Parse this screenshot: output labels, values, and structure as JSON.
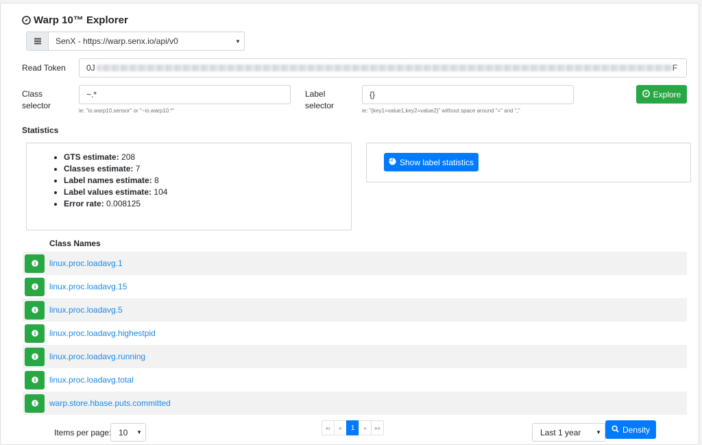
{
  "app": {
    "title": "Warp 10™ Explorer"
  },
  "endpoint": {
    "selected": "SenX - https://warp.senx.io/api/v0"
  },
  "read_token": {
    "label": "Read Token",
    "visible_prefix": "0J",
    "visible_suffix": "F"
  },
  "class_selector": {
    "label_line1": "Class",
    "label_line2": "selector",
    "value": "~.*",
    "hint": "ie: \"io.warp10.sensor\" or \"~io.warp10.*\""
  },
  "label_selector": {
    "label_line1": "Label",
    "label_line2": "selector",
    "value": "{}",
    "hint": "ie: \"{key1=value1,key2=value2}\" without space around \"=\" and \",\""
  },
  "explore_button": {
    "label": "Explore"
  },
  "statistics": {
    "title": "Statistics",
    "items": [
      {
        "key": "GTS estimate:",
        "value": "208"
      },
      {
        "key": "Classes estimate:",
        "value": "7"
      },
      {
        "key": "Label names estimate:",
        "value": "8"
      },
      {
        "key": "Label values estimate:",
        "value": "104"
      },
      {
        "key": "Error rate:",
        "value": "0.008125"
      }
    ],
    "label_stats_button": "Show label statistics"
  },
  "class_table": {
    "header": "Class Names",
    "rows": [
      "linux.proc.loadavg.1",
      "linux.proc.loadavg.15",
      "linux.proc.loadavg.5",
      "linux.proc.loadavg.highestpid",
      "linux.proc.loadavg.running",
      "linux.proc.loadavg.total",
      "warp.store.hbase.puts.committed"
    ]
  },
  "pagination": {
    "items_per_page_label": "Items per page:",
    "items_per_page_value": "10",
    "first": "«‹",
    "prev": "«",
    "current": "1",
    "next": "»",
    "last": "»»"
  },
  "range": {
    "selected": "Last 1 year"
  },
  "density_button": {
    "label": "Density"
  },
  "colors": {
    "green": "#28a745",
    "blue": "#007bff",
    "link": "#1e88e5"
  },
  "icons": {
    "title": "explore-compass-icon",
    "endpoint": "server-list-icon",
    "explore": "compass-icon",
    "label_stats": "pie-chart-icon",
    "row": "info-icon",
    "density": "search-icon"
  }
}
